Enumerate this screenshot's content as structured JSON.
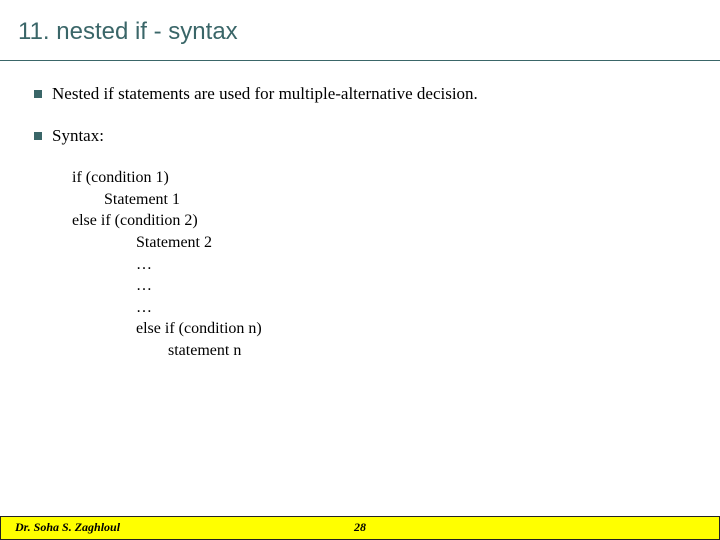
{
  "title": "11.  nested if - syntax",
  "bullets": {
    "b1": "Nested if statements are used for multiple-alternative decision.",
    "b2": "Syntax:"
  },
  "syntax": {
    "l1": "if (condition 1)",
    "l2": "Statement 1",
    "l3": "else if (condition 2)",
    "l4": "Statement 2",
    "l5": "…",
    "l6": "…",
    "l7": "…",
    "l8": "else if (condition n)",
    "l9": "statement n"
  },
  "footer": {
    "author": "Dr. Soha S. Zaghloul",
    "page": "28"
  }
}
